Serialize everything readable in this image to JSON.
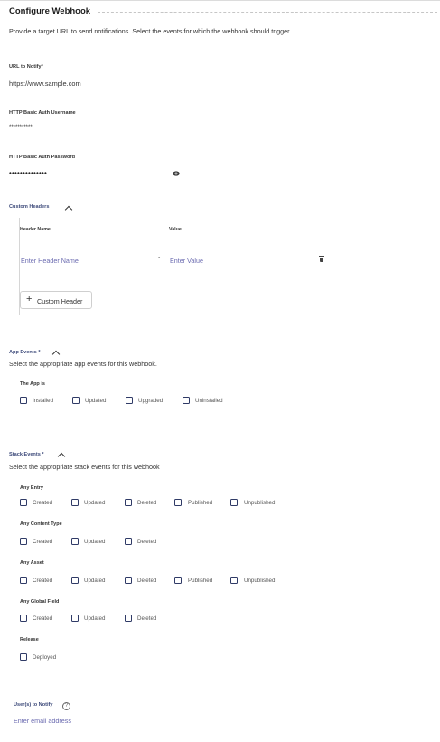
{
  "header": {
    "title": "Configure Webhook",
    "description": "Provide a target URL to send notifications. Select the events for which the webhook should trigger."
  },
  "url": {
    "label": "URL to Notify*",
    "value": "https://www.sample.com"
  },
  "username": {
    "label": "HTTP Basic Auth Username",
    "value": "***********"
  },
  "password": {
    "label": "HTTP Basic Auth Password",
    "value": "••••••••••••••",
    "icon": "eye-icon"
  },
  "custom_headers": {
    "label": "Custom Headers",
    "col_name": "Header Name",
    "col_value": "Value",
    "name_placeholder": "Enter Header Name",
    "separator": "-",
    "value_placeholder": "Enter Value",
    "add_label": "Custom Header",
    "add_icon": "+"
  },
  "app_events": {
    "label": "App Events *",
    "description": "Select the appropriate app events for this webhook.",
    "group": "The App is",
    "options": [
      "Installed",
      "Updated",
      "Upgraded",
      "Uninstalled"
    ]
  },
  "stack_events": {
    "label": "Stack Events *",
    "description": "Select the appropriate stack events for this webhook",
    "any_entry": {
      "label": "Any Entry",
      "options": [
        "Created",
        "Updated",
        "Deleted",
        "Published",
        "Unpublished"
      ]
    },
    "any_content_type": {
      "label": "Any Content Type",
      "options": [
        "Created",
        "Updated",
        "Deleted"
      ]
    },
    "any_asset": {
      "label": "Any Asset",
      "options": [
        "Created",
        "Updated",
        "Deleted",
        "Published",
        "Unpublished"
      ]
    },
    "any_global_field": {
      "label": "Any Global Field",
      "options": [
        "Created",
        "Updated",
        "Deleted"
      ]
    },
    "release": {
      "label": "Release",
      "options": [
        "Deployed"
      ]
    }
  },
  "notify": {
    "label": "User(s) to Notify",
    "help": "?",
    "placeholder": "Enter email address"
  },
  "colors": {
    "checkbox_border": "#2f3a66",
    "placeholder": "#6b6bb0"
  }
}
